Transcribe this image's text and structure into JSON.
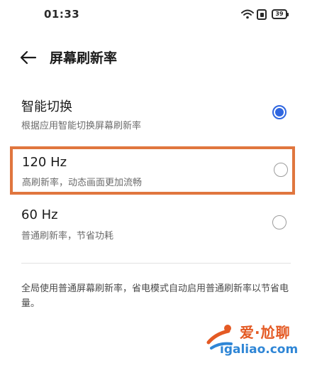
{
  "status_bar": {
    "time": "01:33",
    "battery": "39",
    "icons": [
      "wifi-icon",
      "sim-icon",
      "battery-icon"
    ]
  },
  "header": {
    "back_icon": "arrow-left-icon",
    "title": "屏幕刷新率"
  },
  "options": [
    {
      "title": "智能切换",
      "subtitle": "根据应用智能切换屏幕刷新率",
      "selected": true
    },
    {
      "title": "120 Hz",
      "subtitle": "高刷新率，动态画面更加流畅",
      "selected": false,
      "highlighted": true
    },
    {
      "title": "60 Hz",
      "subtitle": "普通刷新率，节省功耗",
      "selected": false
    }
  ],
  "note": "全局使用普通屏幕刷新率，省电模式自动启用普通刷新率以节省电量。",
  "watermark": {
    "name": "爱·尬聊",
    "url": "igaliao.com"
  },
  "colors": {
    "accent": "#2f66e0",
    "highlight_border": "#e0763e",
    "watermark_orange": "#e45a24",
    "watermark_blue": "#2f86d6"
  }
}
